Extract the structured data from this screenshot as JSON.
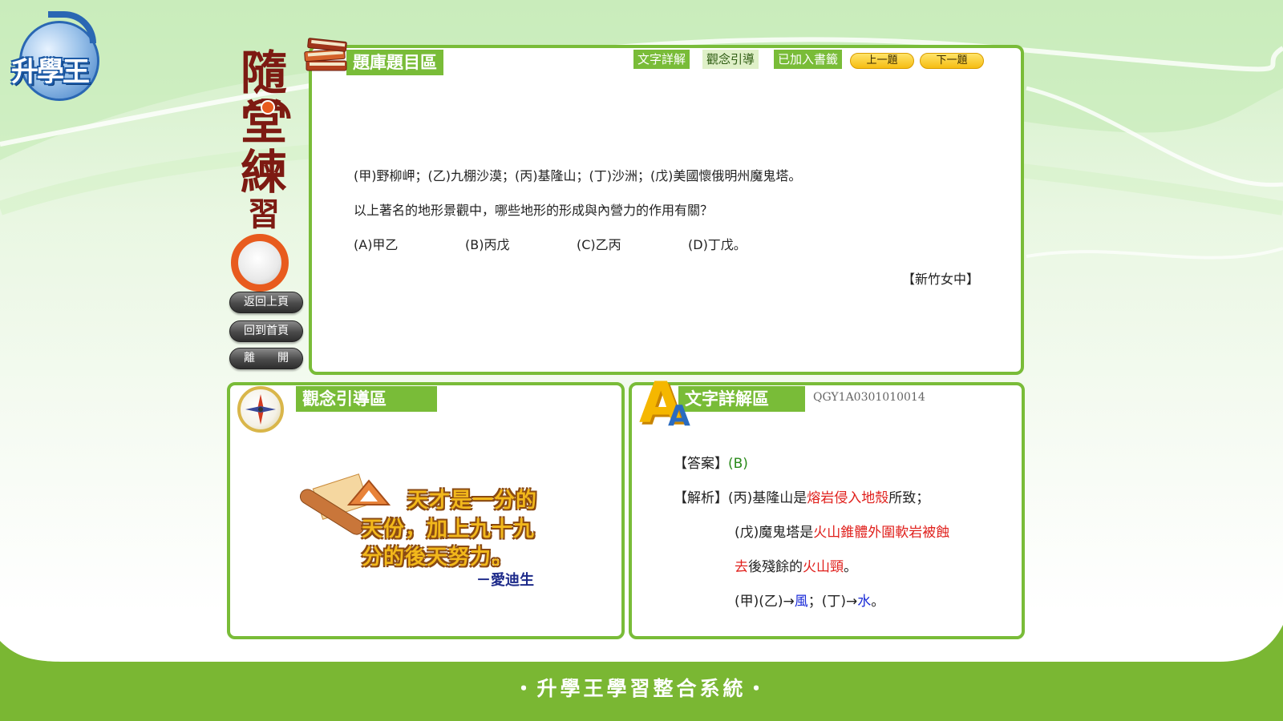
{
  "logo": {
    "text": "升學王"
  },
  "side_title": {
    "chars": [
      "隨",
      "堂",
      "練",
      "習"
    ]
  },
  "side_buttons": {
    "back": "返回上頁",
    "home": "回到首頁",
    "exit": "離　　開"
  },
  "question_panel": {
    "title": "題庫題目區",
    "tabs": {
      "detail": "文字詳解",
      "concept": "觀念引導",
      "bookmark": "已加入書籤"
    },
    "nav": {
      "prev": "上一題",
      "next": "下一題"
    },
    "line1": "(甲)野柳岬；(乙)九棚沙漠；(丙)基隆山；(丁)沙洲；(戊)美國懷俄明州魔鬼塔。",
    "line2": "以上著名的地形景觀中，哪些地形的形成與內營力的作用有關？",
    "options": [
      "(A)甲乙",
      "(B)丙戊",
      "(C)乙丙",
      "(D)丁戊。"
    ],
    "source": "【新竹女中】"
  },
  "concept_panel": {
    "title": "觀念引導區",
    "quote": [
      "天才是一分的",
      "天份，加上九十九",
      "分的後天努力。"
    ],
    "author": "－愛迪生"
  },
  "explain_panel": {
    "title": "文字詳解區",
    "id": "QGY1A0301010014",
    "answer_label": "【答案】",
    "answer_value": "(B)",
    "analysis_label": "【解析】",
    "l1a": "(丙)基隆山是",
    "l1b": "熔岩侵入地殼",
    "l1c": "所致；",
    "l2a": "(戊)魔鬼塔是",
    "l2b": "火山錐體外圍軟岩被蝕",
    "l3a": "去",
    "l3b": "後殘餘的",
    "l3c": "火山頸",
    "l3d": "。",
    "l4a": "(甲)(乙)→",
    "l4b": "風",
    "l4c": "；(丁)→",
    "l4d": "水",
    "l4e": "。"
  },
  "footer": {
    "text": "・升學王學習整合系統・"
  },
  "colors": {
    "accent": "#79bc38",
    "highlight_red": "#e0201c",
    "highlight_blue": "#1a2bd8",
    "answer_green": "#2a8a1a"
  }
}
